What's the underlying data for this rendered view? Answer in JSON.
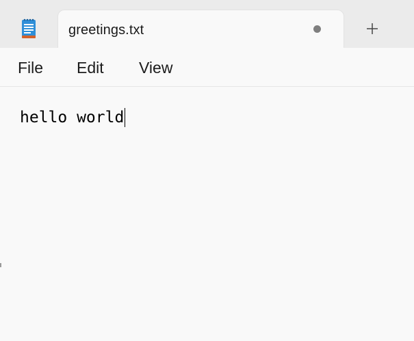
{
  "app": {
    "icon": "notepad-icon"
  },
  "tab": {
    "title": "greetings.txt",
    "unsaved_indicator": "unsaved-dot-icon",
    "new_tab_icon": "plus-icon"
  },
  "menu": {
    "items": [
      {
        "label": "File"
      },
      {
        "label": "Edit"
      },
      {
        "label": "View"
      }
    ]
  },
  "editor": {
    "content": "hello world"
  },
  "colors": {
    "titlebar_bg": "#ebebeb",
    "editor_bg": "#f9f9f9",
    "notepad_icon_blue": "#2f8fd8",
    "notepad_icon_orange": "#d4622a"
  }
}
